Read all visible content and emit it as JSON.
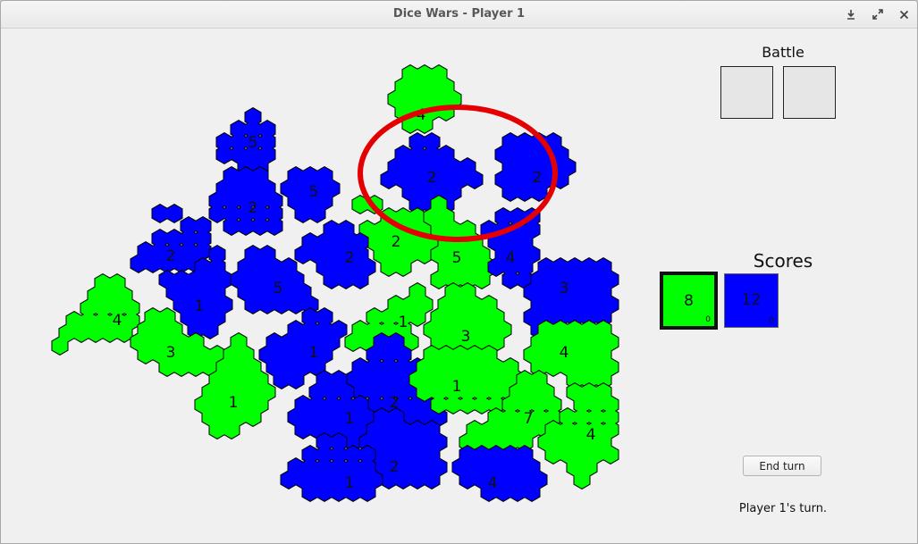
{
  "window": {
    "title": "Dice Wars - Player 1",
    "controls": [
      "download-icon",
      "maximize-icon",
      "close-icon"
    ]
  },
  "colors": {
    "green": "#00ff00",
    "blue": "#0000ff",
    "outline": "#000000",
    "highlight": "#e40000"
  },
  "territories": [
    {
      "owner": "green",
      "dice": "4"
    },
    {
      "owner": "blue",
      "dice": "5"
    },
    {
      "owner": "blue",
      "dice": "5"
    },
    {
      "owner": "blue",
      "dice": "2"
    },
    {
      "owner": "blue",
      "dice": "2"
    },
    {
      "owner": "blue",
      "dice": "2"
    },
    {
      "owner": "blue",
      "dice": "2"
    },
    {
      "owner": "green",
      "dice": "2"
    },
    {
      "owner": "blue",
      "dice": "2"
    },
    {
      "owner": "green",
      "dice": "5"
    },
    {
      "owner": "blue",
      "dice": "4"
    },
    {
      "owner": "blue",
      "dice": "1"
    },
    {
      "owner": "blue",
      "dice": "5"
    },
    {
      "owner": "blue",
      "dice": "3"
    },
    {
      "owner": "green",
      "dice": "4"
    },
    {
      "owner": "green",
      "dice": "3"
    },
    {
      "owner": "green",
      "dice": "1"
    },
    {
      "owner": "green",
      "dice": "3"
    },
    {
      "owner": "blue",
      "dice": "1"
    },
    {
      "owner": "green",
      "dice": "1"
    },
    {
      "owner": "green",
      "dice": "4"
    },
    {
      "owner": "blue",
      "dice": "2"
    },
    {
      "owner": "green",
      "dice": "1"
    },
    {
      "owner": "blue",
      "dice": "1"
    },
    {
      "owner": "green",
      "dice": "7"
    },
    {
      "owner": "green",
      "dice": "4"
    },
    {
      "owner": "blue",
      "dice": "2"
    },
    {
      "owner": "blue",
      "dice": "1"
    },
    {
      "owner": "blue",
      "dice": "4"
    }
  ],
  "battle": {
    "label": "Battle"
  },
  "scores": {
    "label": "Scores",
    "players": [
      {
        "color": "green",
        "value": "8",
        "sub": "0",
        "active": true
      },
      {
        "color": "blue",
        "value": "12",
        "sub": "0",
        "active": false
      }
    ]
  },
  "end_turn_label": "End turn",
  "status": "Player 1's turn."
}
